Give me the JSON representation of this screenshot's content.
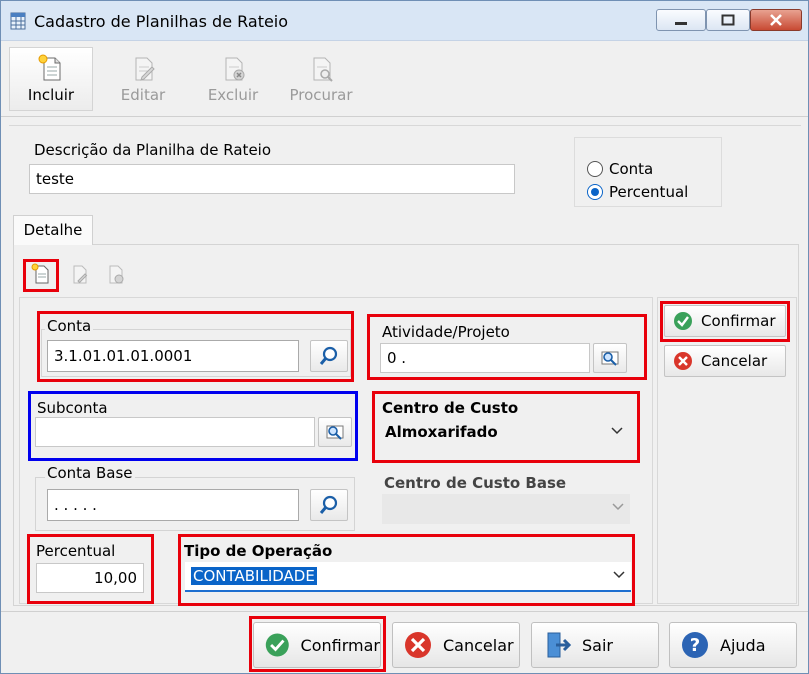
{
  "window": {
    "title": "Cadastro de Planilhas de Rateio"
  },
  "toolbar": {
    "incluir": "Incluir",
    "editar": "Editar",
    "excluir": "Excluir",
    "procurar": "Procurar"
  },
  "form": {
    "descricao_label": "Descrição da Planilha de Rateio",
    "descricao_value": "teste",
    "radio": {
      "conta": "Conta",
      "percentual": "Percentual",
      "selected": "Percentual"
    }
  },
  "tab": {
    "detalhe": "Detalhe"
  },
  "detail": {
    "conta_label": "Conta",
    "conta_value": "3.1.01.01.01.0001",
    "atividade_label": "Atividade/Projeto",
    "atividade_value": "0 .",
    "subconta_label": "Subconta",
    "subconta_value": "",
    "centro_custo_label": "Centro de Custo",
    "centro_custo_value": "Almoxarifado",
    "conta_base_label": "Conta Base",
    "conta_base_value": ". . . . .",
    "centro_custo_base_label": "Centro de Custo Base",
    "centro_custo_base_value": "",
    "percentual_label": "Percentual",
    "percentual_value": "10,00",
    "tipo_operacao_label": "Tipo de Operação",
    "tipo_operacao_value": "CONTABILIDADE"
  },
  "side": {
    "confirmar": "Confirmar",
    "cancelar": "Cancelar"
  },
  "footer": {
    "confirmar": "Confirmar",
    "cancelar": "Cancelar",
    "sair": "Sair",
    "ajuda": "Ajuda"
  },
  "colors": {
    "highlight_red": "#e8000b",
    "highlight_blue": "#0000ee",
    "accent": "#0a64c8"
  }
}
